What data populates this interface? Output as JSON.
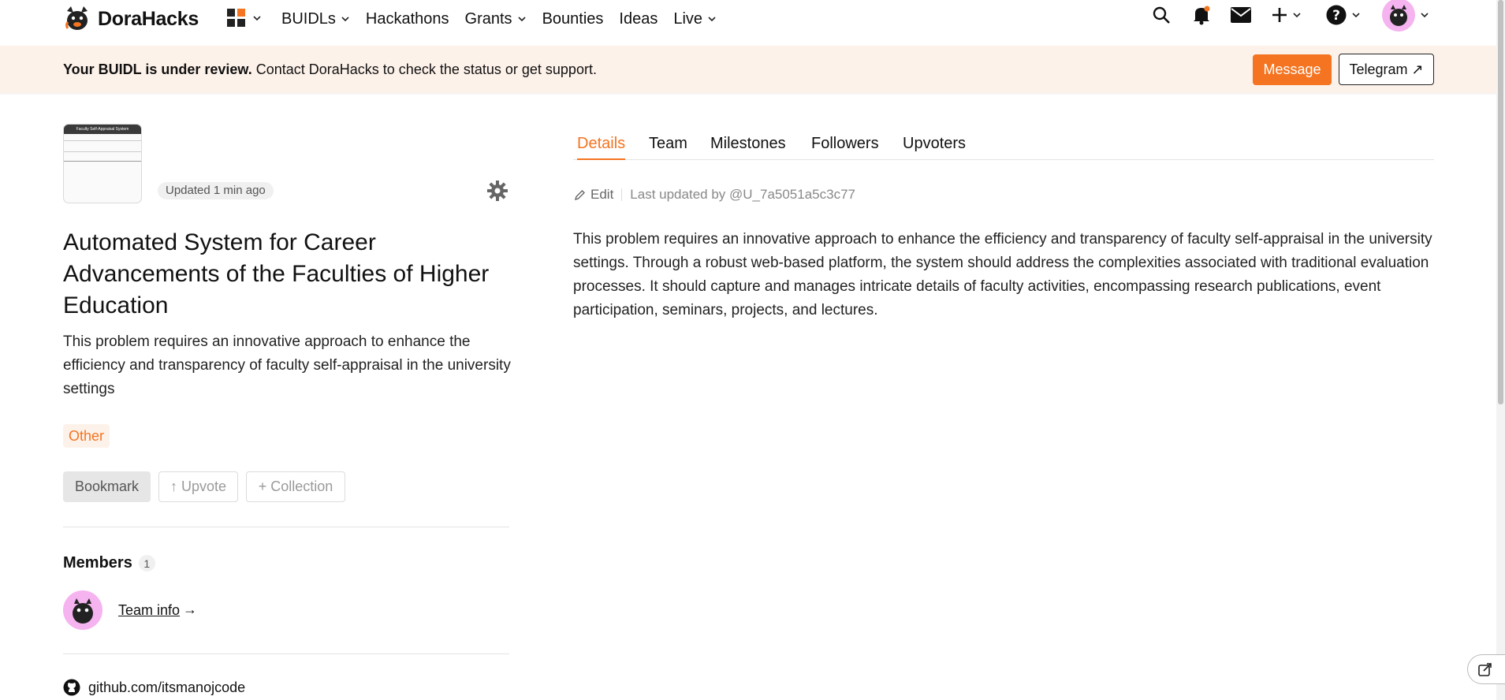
{
  "brand": {
    "name": "DoraHacks"
  },
  "nav": {
    "items": [
      {
        "label": "BUIDLs",
        "dropdown": true
      },
      {
        "label": "Hackathons",
        "dropdown": false
      },
      {
        "label": "Grants",
        "dropdown": true
      },
      {
        "label": "Bounties",
        "dropdown": false
      },
      {
        "label": "Ideas",
        "dropdown": false
      },
      {
        "label": "Live",
        "dropdown": true
      }
    ],
    "right_icons": [
      "search-icon",
      "bell-icon",
      "mail-icon",
      "plus-icon",
      "help-icon",
      "avatar"
    ]
  },
  "banner": {
    "bold": "Your BUIDL is under review.",
    "text": " Contact DoraHacks to check the status or get support.",
    "message_label": "Message",
    "telegram_label": "Telegram ↗"
  },
  "project": {
    "thumbnail_title": "Faculty Self-Appraisal System",
    "updated": "Updated 1 min ago",
    "title": "Automated System for Career Advancements of the Faculties of Higher Education",
    "subtitle": "This problem requires an innovative approach to enhance the efficiency and transparency of faculty self-appraisal in the university settings",
    "tag": "Other",
    "bookmark_label": "Bookmark",
    "upvote_label": "↑ Upvote",
    "collection_label": "+ Collection",
    "members_label": "Members",
    "members_count": "1",
    "team_info_label": "Team info",
    "team_info_arrow": "→",
    "github": "github.com/itsmanojcode"
  },
  "tabs": [
    "Details",
    "Team",
    "Milestones",
    "Followers",
    "Upvoters"
  ],
  "details": {
    "edit_label": "Edit",
    "last_updated": "Last updated by @U_7a5051a5c3c77",
    "body": "This problem requires an innovative approach to enhance the efficiency and transparency of faculty self-appraisal in the university settings. Through a robust web-based platform, the system should address the complexities associated with traditional evaluation processes. It should capture and manages intricate details of faculty activities, encompassing research publications, event participation, seminars, projects, and lectures."
  },
  "colors": {
    "accent": "#f47421",
    "banner_bg": "#fdf2ea",
    "avatar_bg": "#f5b3f0"
  }
}
